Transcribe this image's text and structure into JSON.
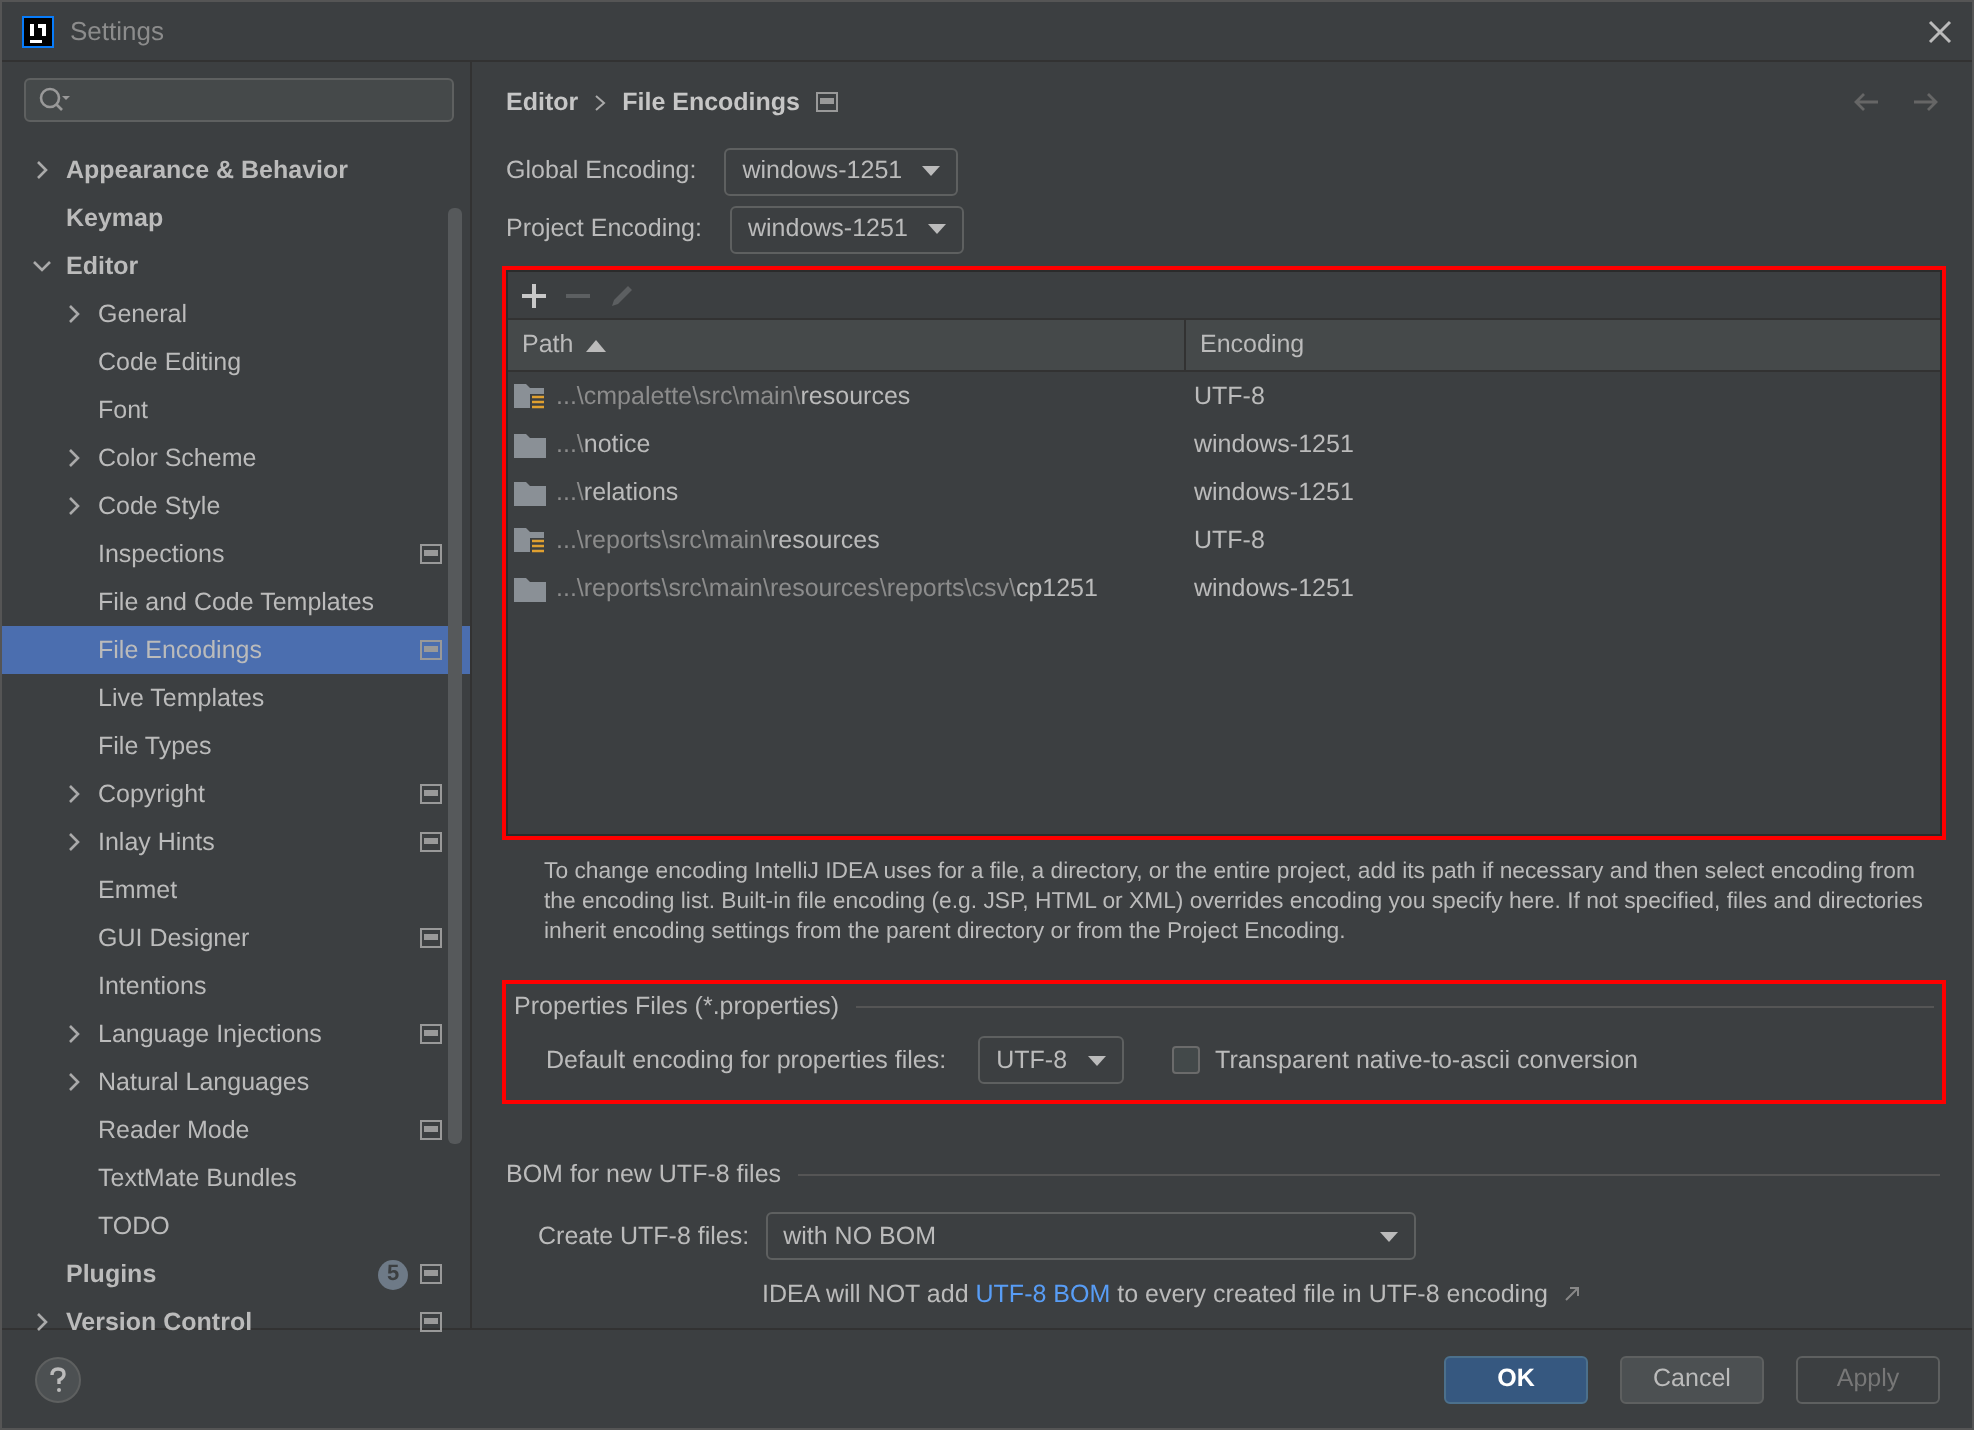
{
  "window": {
    "title": "Settings"
  },
  "sidebar": {
    "items": [
      {
        "label": "Appearance & Behavior",
        "bold": true,
        "expanded": false,
        "selected": false
      },
      {
        "label": "Keymap",
        "bold": true,
        "selected": false
      },
      {
        "label": "Editor",
        "bold": true,
        "expanded": true,
        "selected": false,
        "children": [
          {
            "label": "General",
            "expanded": false,
            "selected": false
          },
          {
            "label": "Code Editing",
            "selected": false
          },
          {
            "label": "Font",
            "selected": false
          },
          {
            "label": "Color Scheme",
            "expanded": false,
            "selected": false
          },
          {
            "label": "Code Style",
            "expanded": false,
            "selected": false
          },
          {
            "label": "Inspections",
            "scoped": true,
            "selected": false
          },
          {
            "label": "File and Code Templates",
            "selected": false
          },
          {
            "label": "File Encodings",
            "scoped": true,
            "selected": true
          },
          {
            "label": "Live Templates",
            "selected": false
          },
          {
            "label": "File Types",
            "selected": false
          },
          {
            "label": "Copyright",
            "expanded": false,
            "scoped": true,
            "selected": false
          },
          {
            "label": "Inlay Hints",
            "expanded": false,
            "scoped": true,
            "selected": false
          },
          {
            "label": "Emmet",
            "selected": false
          },
          {
            "label": "GUI Designer",
            "scoped": true,
            "selected": false
          },
          {
            "label": "Intentions",
            "selected": false
          },
          {
            "label": "Language Injections",
            "expanded": false,
            "scoped": true,
            "selected": false
          },
          {
            "label": "Natural Languages",
            "expanded": false,
            "selected": false
          },
          {
            "label": "Reader Mode",
            "scoped": true,
            "selected": false
          },
          {
            "label": "TextMate Bundles",
            "selected": false
          },
          {
            "label": "TODO",
            "selected": false
          }
        ]
      },
      {
        "label": "Plugins",
        "bold": true,
        "badge": "5",
        "scoped": true,
        "selected": false
      },
      {
        "label": "Version Control",
        "bold": true,
        "expanded": false,
        "scoped": true,
        "selected": false
      }
    ]
  },
  "breadcrumb": [
    "Editor",
    "File Encodings"
  ],
  "global_encoding": {
    "label": "Global Encoding:",
    "value": "windows-1251"
  },
  "project_encoding": {
    "label": "Project Encoding:",
    "value": "windows-1251"
  },
  "toolbar": [
    {
      "kind": "add",
      "disabled": false
    },
    {
      "kind": "remove",
      "disabled": true
    },
    {
      "kind": "edit",
      "disabled": true
    }
  ],
  "table": {
    "columns": [
      {
        "label": "Path",
        "sorted": true
      },
      {
        "label": "Encoding",
        "sorted": false
      }
    ],
    "rows": [
      {
        "kind": "resources",
        "prefix": "...\\cmpalette\\src\\main\\",
        "name": "resources",
        "encoding": "UTF-8"
      },
      {
        "kind": "folder",
        "prefix": "...\\",
        "name": "notice",
        "encoding": "windows-1251"
      },
      {
        "kind": "folder",
        "prefix": "...\\",
        "name": "relations",
        "encoding": "windows-1251"
      },
      {
        "kind": "resources",
        "prefix": "...\\reports\\src\\main\\",
        "name": "resources",
        "encoding": "UTF-8"
      },
      {
        "kind": "folder",
        "prefix": "...\\reports\\src\\main\\resources\\reports\\csv\\",
        "name": "cp1251",
        "encoding": "windows-1251"
      }
    ]
  },
  "hint": "To change encoding IntelliJ IDEA uses for a file, a directory, or the entire project, add its path if necessary and then select encoding from the encoding list. Built-in file encoding (e.g. JSP, HTML or XML) overrides encoding you specify here. If not specified, files and directories inherit encoding settings from the parent directory or from the Project Encoding.",
  "properties": {
    "title": "Properties Files (*.properties)",
    "label": "Default encoding for properties files:",
    "value": "UTF-8",
    "checkbox": {
      "label": "Transparent native-to-ascii conversion",
      "checked": false
    }
  },
  "bom": {
    "title": "BOM for new UTF-8 files",
    "label": "Create UTF-8 files:",
    "value": "with NO BOM",
    "note_before": "IDEA will NOT add ",
    "link": "UTF-8 BOM",
    "note_after": " to every created file in UTF-8 encoding"
  },
  "buttons": [
    {
      "label": "OK",
      "kind": "primary",
      "disabled": false
    },
    {
      "label": "Cancel",
      "kind": "default",
      "disabled": false
    },
    {
      "label": "Apply",
      "kind": "default",
      "disabled": true
    }
  ]
}
